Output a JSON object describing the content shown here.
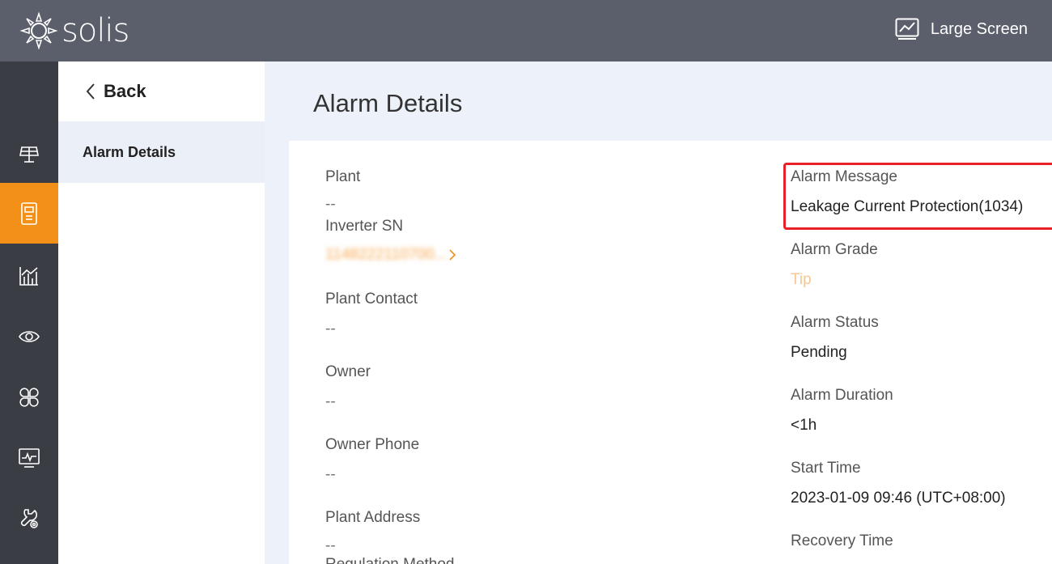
{
  "header": {
    "logo_text": "solis",
    "large_screen_label": "Large Screen"
  },
  "leftnav": {
    "items": [
      {
        "icon": "solar-panel-icon",
        "active": false
      },
      {
        "icon": "device-icon",
        "active": true
      },
      {
        "icon": "chart-icon",
        "active": false
      },
      {
        "icon": "eye-icon",
        "active": false
      },
      {
        "icon": "apps-icon",
        "active": false
      },
      {
        "icon": "monitor-icon",
        "active": false
      },
      {
        "icon": "service-icon",
        "active": false
      }
    ]
  },
  "subnav": {
    "back_label": "Back",
    "items": [
      {
        "label": "Alarm Details",
        "active": true
      }
    ]
  },
  "main": {
    "title": "Alarm Details",
    "left_fields": {
      "plant": {
        "label": "Plant",
        "value": "--"
      },
      "inverter_sn": {
        "label": "Inverter SN",
        "value": "1148222110700..."
      },
      "plant_contact": {
        "label": "Plant Contact",
        "value": "--"
      },
      "owner": {
        "label": "Owner",
        "value": "--"
      },
      "owner_phone": {
        "label": "Owner Phone",
        "value": "--"
      },
      "plant_address": {
        "label": "Plant Address",
        "value": "--"
      },
      "regulation_method": {
        "label": "Regulation Method"
      }
    },
    "right_fields": {
      "alarm_message": {
        "label": "Alarm Message",
        "value": "Leakage Current Protection(1034)"
      },
      "alarm_grade": {
        "label": "Alarm Grade",
        "value": "Tip"
      },
      "alarm_status": {
        "label": "Alarm Status",
        "value": "Pending"
      },
      "alarm_duration": {
        "label": "Alarm Duration",
        "value": "<1h"
      },
      "start_time": {
        "label": "Start Time",
        "value": "2023-01-09 09:46 (UTC+08:00)"
      },
      "recovery_time": {
        "label": "Recovery Time"
      }
    }
  },
  "colors": {
    "header_bg": "#5b5e6b",
    "nav_bg": "#3b3d44",
    "accent": "#f39018",
    "highlight": "#e8202a",
    "tip": "#f6c694"
  }
}
